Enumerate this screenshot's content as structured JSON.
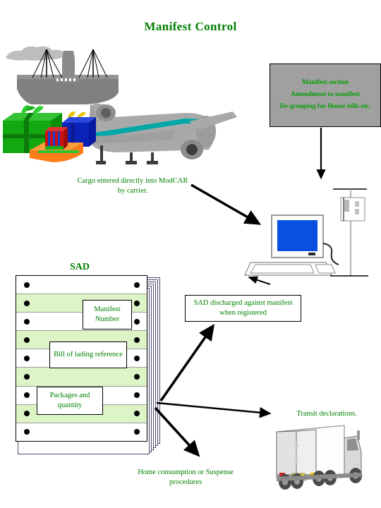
{
  "page": {
    "title": "Manifest Control",
    "title_color": "#008000",
    "background": "#ffffff"
  },
  "manifest_section": {
    "box_color": "#a0a0a0",
    "text_color": "#00a000",
    "lines": [
      "Manifest section",
      "Amendment to manifest",
      "De-grouping for House bills etc."
    ]
  },
  "notes": {
    "cargo": "Cargo entered directly into ModCAR by carrier.",
    "sad_discharged": "SAD discharged against manifest when registered",
    "transit": "Transit declarations.",
    "home_consumption": "Home consumption or Suspense procedures"
  },
  "sad": {
    "label": "SAD",
    "fields": [
      {
        "name": "manifest-number",
        "text": "Manifest Number"
      },
      {
        "name": "bill-of-lading",
        "text": "Bill of lading reference"
      },
      {
        "name": "packages",
        "text": "Packages and quantity"
      }
    ],
    "row_colors": {
      "odd": "#ffffff",
      "even": "#ddf5c6"
    },
    "row_count": 9,
    "stack_sheets": 7
  },
  "graphics": {
    "ship": {
      "name": "cargo-ship",
      "hull_color": "#808080",
      "smoke_color": "#c0c0c0"
    },
    "airplane": {
      "name": "cargo-airplane",
      "body_color": "#a9a9a9",
      "stripe_color": "#00a0a0"
    },
    "gifts": {
      "name": "gift-packages",
      "colors": [
        "#00b000",
        "#0000cc",
        "#ff8000",
        "#cc0000"
      ]
    },
    "computer": {
      "name": "computer-workstation",
      "screen_color": "#0a50e0",
      "case_color": "#ffffff"
    },
    "truck": {
      "name": "cargo-truck",
      "trailer_color": "#ffffff",
      "cab_color": "#d8d8d8"
    },
    "arrows": {
      "color": "#000000",
      "items": [
        {
          "name": "arrow-manifest-to-computer",
          "direction": "down"
        },
        {
          "name": "arrow-cargo-to-computer",
          "direction": "down-right"
        },
        {
          "name": "arrow-computer-to-sad-discharged",
          "direction": "up-left"
        },
        {
          "name": "arrow-sad-to-discharged",
          "direction": "up-right"
        },
        {
          "name": "arrow-sad-to-transit",
          "direction": "right"
        },
        {
          "name": "arrow-sad-to-home-consumption",
          "direction": "down-right"
        }
      ]
    }
  }
}
